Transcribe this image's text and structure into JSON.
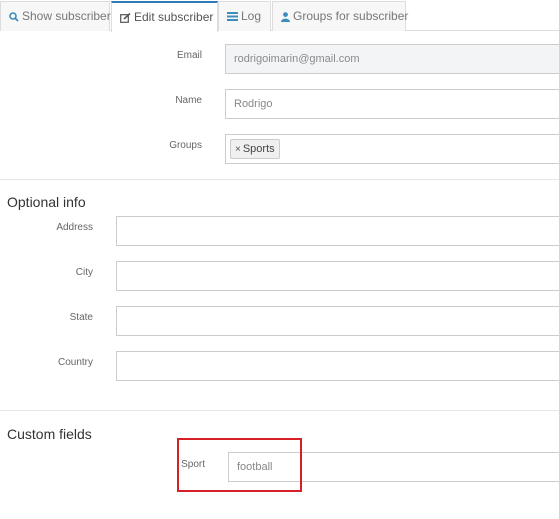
{
  "tabs": [
    {
      "label": "Show subscriber",
      "icon": "search-icon"
    },
    {
      "label": "Edit subscriber",
      "icon": "edit-icon"
    },
    {
      "label": "Log",
      "icon": "list-icon"
    },
    {
      "label": "Groups for subscriber",
      "icon": "user-icon"
    }
  ],
  "form": {
    "email": {
      "label": "Email",
      "value": "rodrigoimarin@gmail.com"
    },
    "name": {
      "label": "Name",
      "value": "Rodrigo"
    },
    "groups": {
      "label": "Groups",
      "tag_remove": "×",
      "tag": "Sports"
    }
  },
  "optional": {
    "title": "Optional info",
    "address": {
      "label": "Address",
      "value": ""
    },
    "city": {
      "label": "City",
      "value": ""
    },
    "state": {
      "label": "State",
      "value": ""
    },
    "country": {
      "label": "Country",
      "value": ""
    }
  },
  "custom": {
    "title": "Custom fields",
    "sport": {
      "label": "Sport",
      "value": "football"
    }
  },
  "colors": {
    "active_tab_border": "#337ab7",
    "highlight": "#d61f26",
    "icon": "#3c8dbc"
  }
}
